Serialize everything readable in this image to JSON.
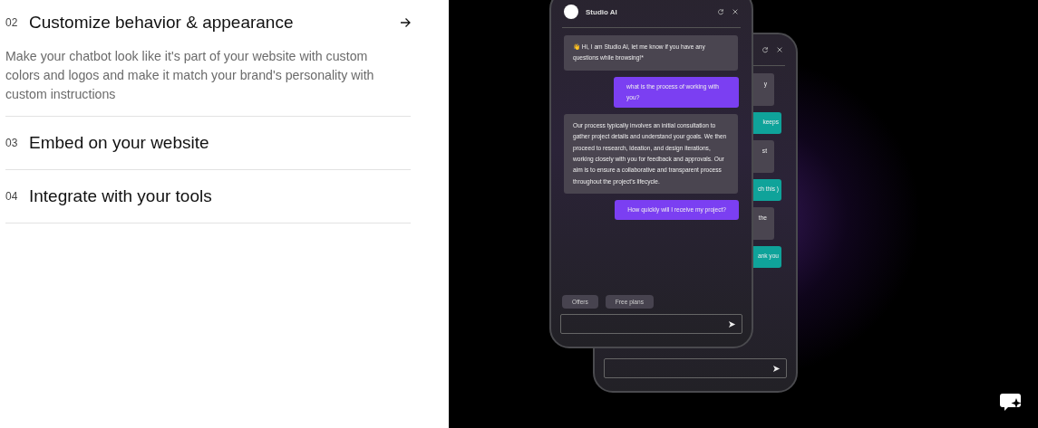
{
  "features": [
    {
      "number": "02",
      "title": "Customize behavior & appearance",
      "expanded": true,
      "description": "Make your chatbot look like it's part of your website with custom colors and logos and make it match your brand's personality with custom instructions"
    },
    {
      "number": "03",
      "title": "Embed on your website",
      "expanded": false
    },
    {
      "number": "04",
      "title": "Integrate with your tools",
      "expanded": false
    }
  ],
  "back_chat": {
    "messages": [
      {
        "kind": "bot",
        "text": "y"
      },
      {
        "kind": "user",
        "text": "keeps"
      },
      {
        "kind": "bot",
        "text": "st"
      },
      {
        "kind": "user",
        "text": "ch this )"
      },
      {
        "kind": "bot",
        "text": "the"
      },
      {
        "kind": "user",
        "text": "ank you"
      }
    ]
  },
  "front_chat": {
    "title": "Studio AI",
    "messages": [
      {
        "kind": "bot",
        "text": "👋 Hi, I am Studio AI, let me know if you have any questions while browsing!*"
      },
      {
        "kind": "user",
        "text": "what is the process of working with you?"
      },
      {
        "kind": "bot",
        "text": "Our process typically involves an initial consultation to gather project details and understand your goals. We then proceed to research, ideation, and design iterations, working closely with you for feedback and approvals. Our aim is to ensure a collaborative and transparent process throughout the project's lifecycle."
      },
      {
        "kind": "user",
        "text": "How quickly will I receive my project?"
      }
    ],
    "suggestions": [
      "Offers",
      "Free plans"
    ]
  }
}
